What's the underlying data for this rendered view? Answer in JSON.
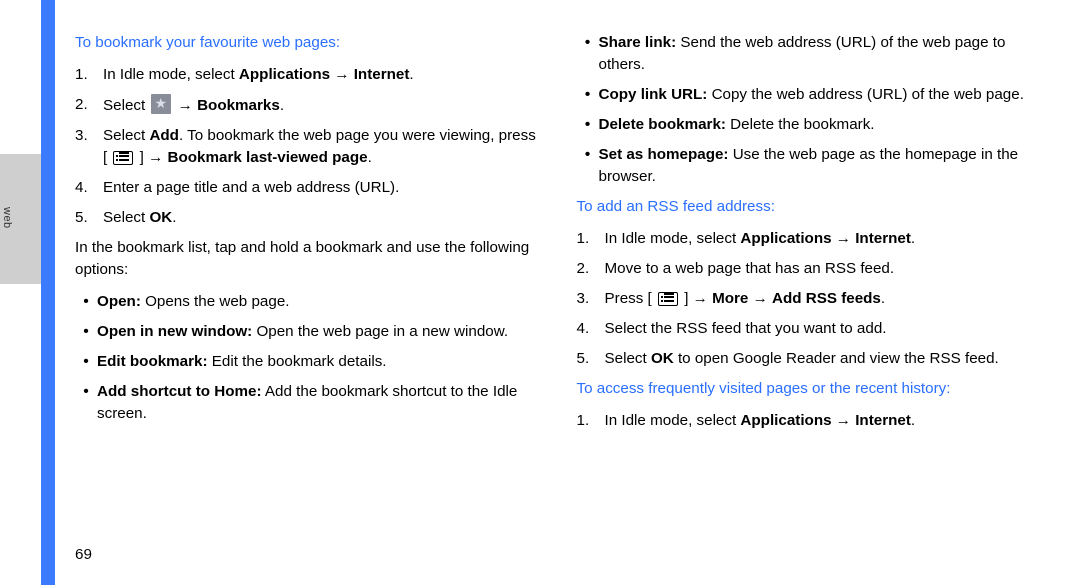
{
  "side": {
    "label": "web"
  },
  "pageNumber": "69",
  "left": {
    "heading1": "To bookmark your favourite web pages:",
    "ol1": [
      {
        "n": "1.",
        "pre": "In Idle mode, select ",
        "b1": "Applications",
        "mid": " → ",
        "b2": "Internet",
        "post": "."
      },
      {
        "n": "2.",
        "pre": "Select ",
        "icon": "star",
        "mid": " → ",
        "b1": "Bookmarks",
        "post": "."
      },
      {
        "n": "3.",
        "pre": "Select ",
        "b1": "Add",
        "mid": ". To bookmark the web page you were viewing, press [ ",
        "icon": "menu",
        "mid2": " ] → ",
        "b2": "Bookmark last-viewed page",
        "post": "."
      },
      {
        "n": "4.",
        "pre": "Enter a page title and a web address (URL)."
      },
      {
        "n": "5.",
        "pre": "Select ",
        "b1": "OK",
        "post": "."
      }
    ],
    "para1": "In the bookmark list, tap and hold a bookmark and use the following options:",
    "ul1": [
      {
        "b": "Open:",
        "t": " Opens the web page."
      },
      {
        "b": "Open in new window:",
        "t": " Open the web page in a new window."
      },
      {
        "b": "Edit bookmark:",
        "t": " Edit the bookmark details."
      },
      {
        "b": "Add shortcut to Home:",
        "t": " Add the bookmark shortcut to the Idle screen."
      }
    ]
  },
  "right": {
    "ul1": [
      {
        "b": "Share link:",
        "t": " Send the web address (URL) of the web page to others."
      },
      {
        "b": "Copy link URL:",
        "t": " Copy the web address (URL) of the web page."
      },
      {
        "b": "Delete bookmark:",
        "t": " Delete the bookmark."
      },
      {
        "b": "Set as homepage:",
        "t": " Use the web page as the homepage in the browser."
      }
    ],
    "heading2": "To add an RSS feed address:",
    "ol2": [
      {
        "n": "1.",
        "pre": "In Idle mode, select ",
        "b1": "Applications",
        "mid": " → ",
        "b2": "Internet",
        "post": "."
      },
      {
        "n": "2.",
        "pre": "Move to a web page that has an RSS feed."
      },
      {
        "n": "3.",
        "pre": "Press [ ",
        "icon": "menu",
        "mid": " ] → ",
        "b1": "More",
        "mid2": " → ",
        "b2": "Add RSS feeds",
        "post": "."
      },
      {
        "n": "4.",
        "pre": "Select the RSS feed that you want to add."
      },
      {
        "n": "5.",
        "pre": "Select ",
        "b1": "OK",
        "post": " to open Google Reader and view the RSS feed."
      }
    ],
    "heading3": "To access frequently visited pages or the recent history:",
    "ol3": [
      {
        "n": "1.",
        "pre": "In Idle mode, select ",
        "b1": "Applications",
        "mid": " → ",
        "b2": "Internet",
        "post": "."
      }
    ]
  }
}
